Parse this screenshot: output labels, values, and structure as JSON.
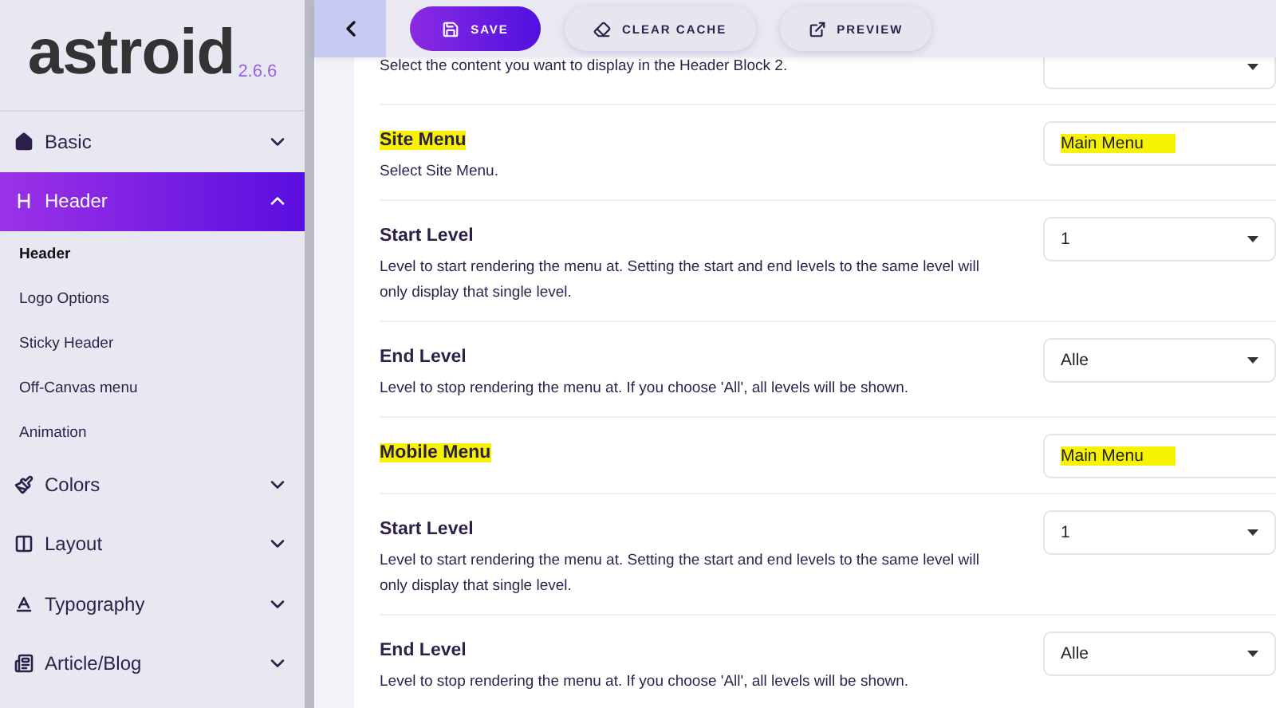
{
  "sidebar": {
    "logo": "astroid",
    "version": "2.6.6",
    "items": [
      {
        "label": "Basic",
        "expanded": false,
        "selected": false
      },
      {
        "label": "Header",
        "expanded": true,
        "selected": true,
        "children": [
          {
            "label": "Header",
            "selected": true
          },
          {
            "label": "Logo Options",
            "selected": false
          },
          {
            "label": "Sticky Header",
            "selected": false
          },
          {
            "label": "Off-Canvas menu",
            "selected": false
          },
          {
            "label": "Animation",
            "selected": false
          }
        ]
      },
      {
        "label": "Colors",
        "expanded": false,
        "selected": false
      },
      {
        "label": "Layout",
        "expanded": false,
        "selected": false
      },
      {
        "label": "Typography",
        "expanded": false,
        "selected": false
      },
      {
        "label": "Article/Blog",
        "expanded": false,
        "selected": false
      }
    ]
  },
  "toolbar": {
    "buttons": [
      {
        "label": "SAVE",
        "kind": "primary"
      },
      {
        "label": "CLEAR CACHE",
        "kind": "secondary"
      },
      {
        "label": "PREVIEW",
        "kind": "secondary"
      }
    ]
  },
  "settings": [
    {
      "description": "Select the content you want to display in the Header Block 2.",
      "field": {
        "kind": "select"
      }
    },
    {
      "title": "Site Menu",
      "description": "Select Site Menu.",
      "field": {
        "kind": "text",
        "value": "Main Menu",
        "highlighted": true
      },
      "highlighted": true
    },
    {
      "title": "Start Level",
      "description": "Level to start rendering the menu at. Setting the start and end levels to the same level will only display that single level.",
      "field": {
        "kind": "select",
        "value": "1"
      }
    },
    {
      "title": "End Level",
      "description": "Level to stop rendering the menu at. If you choose 'All', all levels will be shown.",
      "field": {
        "kind": "select",
        "value": "Alle"
      }
    },
    {
      "title": "Mobile Menu",
      "field": {
        "kind": "text",
        "value": "Main Menu",
        "highlighted": true
      },
      "highlighted": true
    },
    {
      "title": "Start Level",
      "description": "Level to start rendering the menu at. Setting the start and end levels to the same level will only display that single level.",
      "field": {
        "kind": "select",
        "value": "1"
      }
    },
    {
      "title": "End Level",
      "description": "Level to stop rendering the menu at. If you choose 'All', all levels will be shown.",
      "field": {
        "kind": "select",
        "value": "Alle"
      }
    }
  ]
}
